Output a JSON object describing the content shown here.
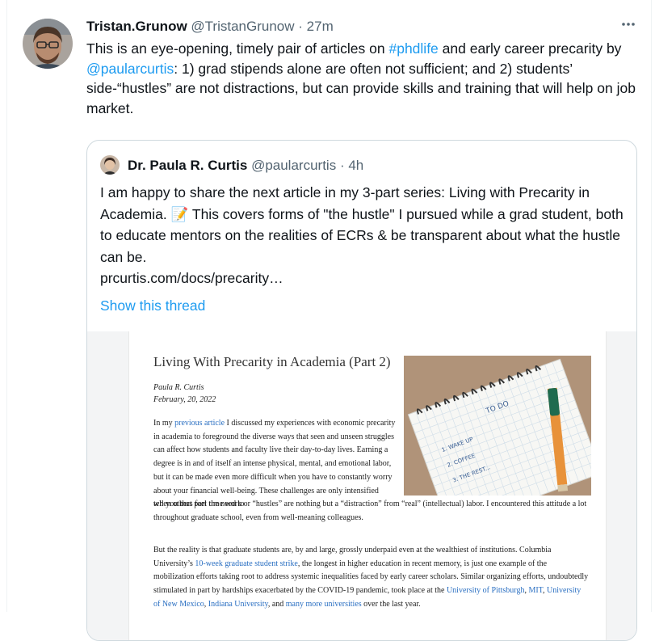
{
  "tweet": {
    "display_name": "Tristan.Grunow",
    "handle": "@TristanGrunow",
    "separator": "·",
    "time": "27m",
    "text_1": "This is an eye-opening, timely pair of articles on ",
    "hashtag": "#phdlife",
    "text_2": " and early career precarity by ",
    "mention": "@paularcurtis",
    "text_3": ": 1) grad stipends alone are often not sufficient; and 2) students’ side-“hustles” are not distractions, but can provide skills and training that will help on job market."
  },
  "quoted_tweet": {
    "display_name": "Dr. Paula R. Curtis",
    "handle": "@paularcurtis",
    "separator": "·",
    "time": "4h",
    "text_1": "I am happy to share the next article in my 3-part series: Living with Precarity in Academia. ",
    "emoji": "📝",
    "text_2": " This covers forms of \"the hustle\" I pursued while a grad student, both to educate mentors on the realities of ECRs & be transparent about what the hustle can be.",
    "url": "prcurtis.com/docs/precarity…",
    "show_thread": "Show this thread"
  },
  "article": {
    "title": "Living With Precarity in Academia (Part 2)",
    "author": "Paula R. Curtis",
    "date": "February, 20, 2022",
    "p1_a": "In my ",
    "p1_link": "previous article",
    "p1_b": " I discussed my experiences with economic precarity in academia to foreground the diverse ways that seen and unseen struggles can affect how students and faculty live their day-to-day lives. Earning a degree is in and of itself an intense physical, mental, and emotional labor, but it can be made even more difficult when you have to constantly worry about your financial well-being. These challenges are only intensified when others feel the need to",
    "p1_c": "tell you that part time work or “hustles” are nothing but a “distraction” from “real” (intellectual) labor. I encountered this attitude a lot throughout graduate school, even from well-meaning colleagues.",
    "p2_a": "But the reality is that graduate students are, by and large, grossly underpaid even at the wealthiest of institutions. Columbia University’s ",
    "p2_link1": "10-week graduate student strike",
    "p2_b": ", the longest in higher education in recent memory, is just one example of the mobilization efforts taking root to address systemic inequalities faced by early career scholars. Similar organizing efforts, undoubtedly stimulated in part by hardships exacerbated by the COVID-19 pandemic, took place at the ",
    "p2_link2": "University of Pittsburgh",
    "p2_c": ", ",
    "p2_link3": "MIT",
    "p2_d": ", ",
    "p2_link4": "University of New Mexico",
    "p2_e": ", ",
    "p2_link5": "Indiana University",
    "p2_f": ", and ",
    "p2_link6": "many more universities",
    "p2_g": " over the last year.",
    "notebook_heading": "TO DO",
    "notebook_items": [
      "1. WAKE UP",
      "2. COFFEE",
      "3. THE REST..."
    ]
  },
  "colors": {
    "link_blue": "#1d9bf0",
    "secondary_text": "#536471",
    "border": "#cfd9de"
  },
  "icons": {
    "more": "more-horizontal-icon"
  }
}
